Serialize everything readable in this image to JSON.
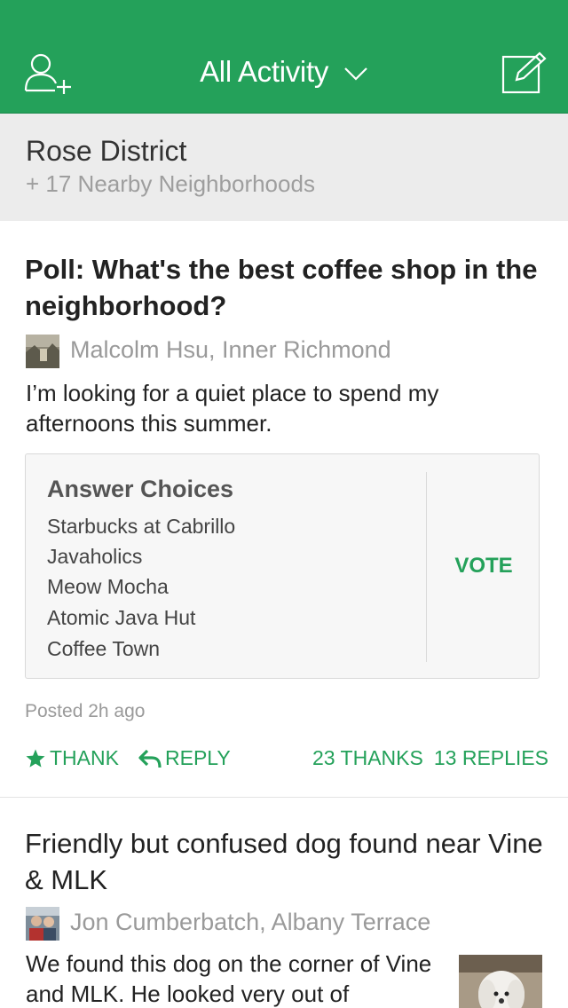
{
  "header": {
    "title": "All Activity",
    "accent_color": "#24a15a",
    "left_icon": "add-neighbor-icon",
    "right_icon": "compose-icon"
  },
  "neighborhood": {
    "name": "Rose District",
    "nearby": "+ 17 Nearby Neighborhoods"
  },
  "posts": [
    {
      "title": "Poll: What's the best coffee shop in the neighborhood?",
      "author": "Malcolm Hsu, Inner Richmond",
      "body": "I’m looking for a quiet place to spend my afternoons this summer.",
      "poll": {
        "heading": "Answer Choices",
        "choices": [
          "Starbucks at Cabrillo",
          "Javaholics",
          "Meow Mocha",
          "Atomic Java Hut",
          "Coffee Town"
        ],
        "vote_label": "VOTE"
      },
      "posted": "Posted 2h ago",
      "thank_label": "THANK",
      "reply_label": "REPLY",
      "thanks_count": "23 THANKS",
      "replies_count": "13 REPLIES"
    },
    {
      "title": "Friendly but confused dog found near Vine & MLK",
      "author": "Jon Cumberbatch, Albany Terrace",
      "body": "We found this dog on the corner of Vine and MLK. He looked very out of"
    }
  ]
}
